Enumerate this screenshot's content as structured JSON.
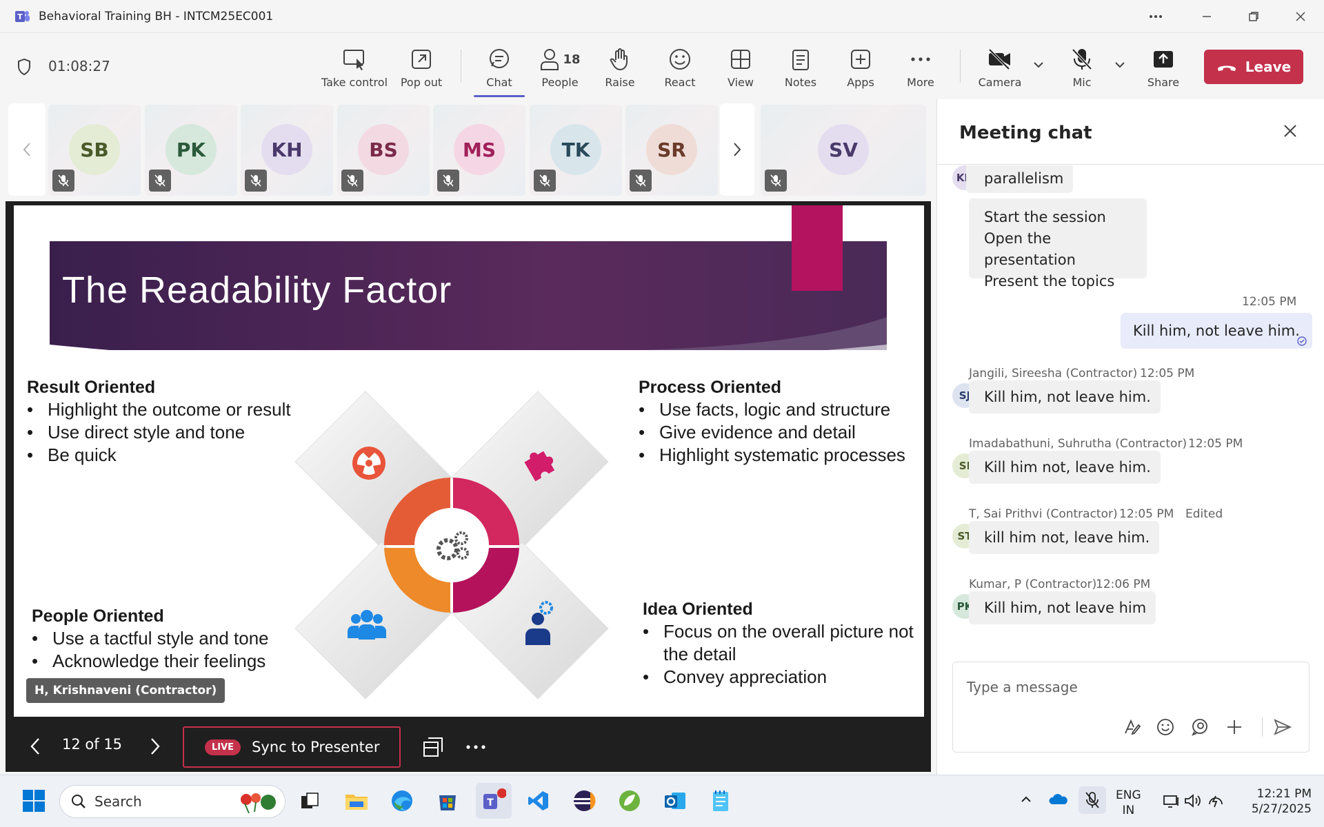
{
  "window": {
    "title": "Behavioral Training BH - INTCM25EC001"
  },
  "toolbar": {
    "timer": "01:08:27",
    "items": [
      {
        "label": "Take control",
        "icon": "take-control-icon"
      },
      {
        "label": "Pop out",
        "icon": "pop-out-icon"
      },
      {
        "label": "Chat",
        "icon": "chat-icon"
      },
      {
        "label": "People",
        "icon": "people-icon",
        "count": "18"
      },
      {
        "label": "Raise",
        "icon": "raise-hand-icon"
      },
      {
        "label": "React",
        "icon": "react-icon"
      },
      {
        "label": "View",
        "icon": "view-icon"
      },
      {
        "label": "Notes",
        "icon": "notes-icon"
      },
      {
        "label": "Apps",
        "icon": "apps-icon"
      },
      {
        "label": "More",
        "icon": "more-icon"
      },
      {
        "label": "Camera",
        "icon": "camera-off-icon"
      },
      {
        "label": "Mic",
        "icon": "mic-off-icon"
      },
      {
        "label": "Share",
        "icon": "share-icon"
      }
    ],
    "leave_label": "Leave"
  },
  "participants": [
    {
      "initials": "SB",
      "bg": "#e4ecd6",
      "fg": "#4a5a2a"
    },
    {
      "initials": "PK",
      "bg": "#d6e8dc",
      "fg": "#2a5a3a"
    },
    {
      "initials": "KH",
      "bg": "#e4ddf0",
      "fg": "#4a3a6a"
    },
    {
      "initials": "BS",
      "bg": "#f2d9e2",
      "fg": "#7a2a4a"
    },
    {
      "initials": "MS",
      "bg": "#f5d6e4",
      "fg": "#a0205a"
    },
    {
      "initials": "TK",
      "bg": "#d8e6ec",
      "fg": "#2a4a5a"
    },
    {
      "initials": "SR",
      "bg": "#efdcd6",
      "fg": "#6a3a2a"
    },
    {
      "initials": "SV",
      "bg": "#e4ddf0",
      "fg": "#4a3a6a"
    }
  ],
  "slide": {
    "title": "The Readability Factor",
    "result": {
      "heading": "Result Oriented",
      "items": [
        "Highlight the outcome or result",
        "Use direct style and tone",
        "Be quick"
      ]
    },
    "process": {
      "heading": "Process Oriented",
      "items": [
        "Use facts, logic and structure",
        "Give evidence and detail",
        "Highlight systematic processes"
      ]
    },
    "people": {
      "heading": "People Oriented",
      "items": [
        "Use a tactful  style and tone",
        "Acknowledge their feelings"
      ]
    },
    "idea": {
      "heading": "Idea Oriented",
      "items": [
        "Focus on the overall picture not the detail",
        "Convey appreciation"
      ]
    },
    "presenter": "H, Krishnaveni (Contractor)",
    "page": "12 of 15",
    "live_label": "LIVE",
    "sync_label": "Sync to Presenter"
  },
  "chat": {
    "heading": "Meeting chat",
    "messages": [
      {
        "initials": "KH",
        "text": "parallelism"
      },
      {
        "lines": [
          "Start the session",
          "Open the presentation",
          "Present the topics"
        ]
      },
      {
        "mine": true,
        "time": "12:05 PM",
        "text": "Kill him, not leave him."
      },
      {
        "initials": "SJ",
        "author": "Jangili, Sireesha (Contractor)",
        "time": "12:05 PM",
        "text": "Kill him, not leave him."
      },
      {
        "initials": "SI",
        "author": "Imadabathuni, Suhrutha (Contractor)",
        "time": "12:05 PM",
        "text": "Kill him not, leave him."
      },
      {
        "initials": "ST",
        "author": "T, Sai Prithvi (Contractor)",
        "time": "12:05 PM",
        "edited": "Edited",
        "text": "kill him not, leave him."
      },
      {
        "initials": "PK",
        "author": "Kumar, P (Contractor)",
        "time": "12:06 PM",
        "text": "Kill him, not leave him"
      }
    ],
    "placeholder": "Type a message"
  },
  "taskbar": {
    "search_label": "Search",
    "lang": "ENG",
    "region": "IN",
    "time": "12:21 PM",
    "date": "5/27/2025"
  }
}
